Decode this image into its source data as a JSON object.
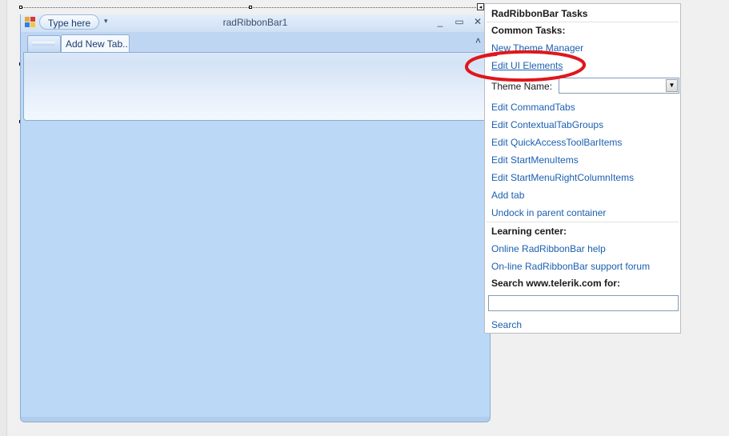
{
  "form": {
    "title": "radRibbonBar1",
    "quick_access_placeholder": "Type here",
    "quick_access_dropdown_glyph": "▾",
    "window_buttons": {
      "minimize": "_",
      "maximize": "▭",
      "close": "✕"
    },
    "tabs": [
      {
        "label": "Add New Tab..."
      }
    ],
    "collapse_glyph": "˄"
  },
  "smart_tag_glyph": "◂",
  "tasks_panel": {
    "title": "RadRibbonBar Tasks",
    "common_tasks_heading": "Common Tasks:",
    "links_top": [
      {
        "label": "New Theme Manager"
      },
      {
        "label": "Edit UI Elements"
      }
    ],
    "theme_name_label": "Theme Name:",
    "theme_name_value": "",
    "theme_dropdown_glyph": "▼",
    "links_main": [
      {
        "label": "Edit CommandTabs"
      },
      {
        "label": "Edit ContextualTabGroups"
      },
      {
        "label": "Edit QuickAccessToolBarItems"
      },
      {
        "label": "Edit StartMenuItems"
      },
      {
        "label": "Edit StartMenuRightColumnItems"
      },
      {
        "label": "Add tab"
      },
      {
        "label": "Undock in parent container"
      }
    ],
    "learning_center_heading": "Learning center:",
    "learning_links": [
      {
        "label": "Online RadRibbonBar help"
      },
      {
        "label": "On-line RadRibbonBar support forum"
      }
    ],
    "search_heading": "Search www.telerik.com for:",
    "search_value": "",
    "search_link": "Search"
  },
  "colors": {
    "link": "#1b5fb0",
    "form_background": "#bcd8f7",
    "annotation": "#e0161c"
  }
}
